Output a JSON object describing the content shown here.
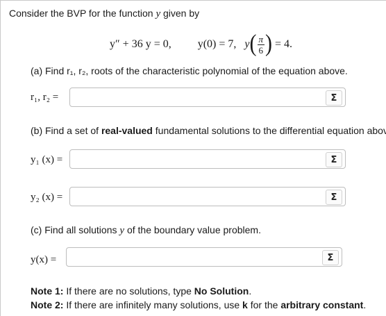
{
  "intro": {
    "prefix": "Consider the BVP for the function",
    "var": "y",
    "suffix": "given by"
  },
  "equation": {
    "ode": "y″ + 36 y = 0,",
    "bc1": "y(0) = 7,",
    "bc2_func": "y",
    "bc2_num": "π",
    "bc2_den": "6",
    "bc2_rhs": "= 4."
  },
  "part_a": {
    "text": "(a) Find r₁, r₂, roots of the characteristic polynomial of the equation above.",
    "label": "r₁, r₂ =",
    "value": "",
    "sigma": "Σ"
  },
  "part_b": {
    "prefix": "(b) Find a set of",
    "bold": "real-valued",
    "suffix": "fundamental solutions to the differential equation above.",
    "y1_label": "y₁ (x) =",
    "y1_value": "",
    "y2_label": "y₂ (x) =",
    "y2_value": "",
    "sigma": "Σ"
  },
  "part_c": {
    "prefix": "(c) Find all solutions",
    "var": "y",
    "suffix": "of the boundary value problem.",
    "label": "y(x) =",
    "value": "",
    "sigma": "Σ"
  },
  "notes": {
    "note1_label": "Note 1:",
    "note1_text": "If there are no solutions, type",
    "note1_bold": "No Solution",
    "note1_end": ".",
    "note2_label": "Note 2:",
    "note2_text": "If there are infinitely many solutions, use",
    "note2_bold_k": "k",
    "note2_mid": "for the",
    "note2_bold_end": "arbitrary constant",
    "note2_end": "."
  }
}
